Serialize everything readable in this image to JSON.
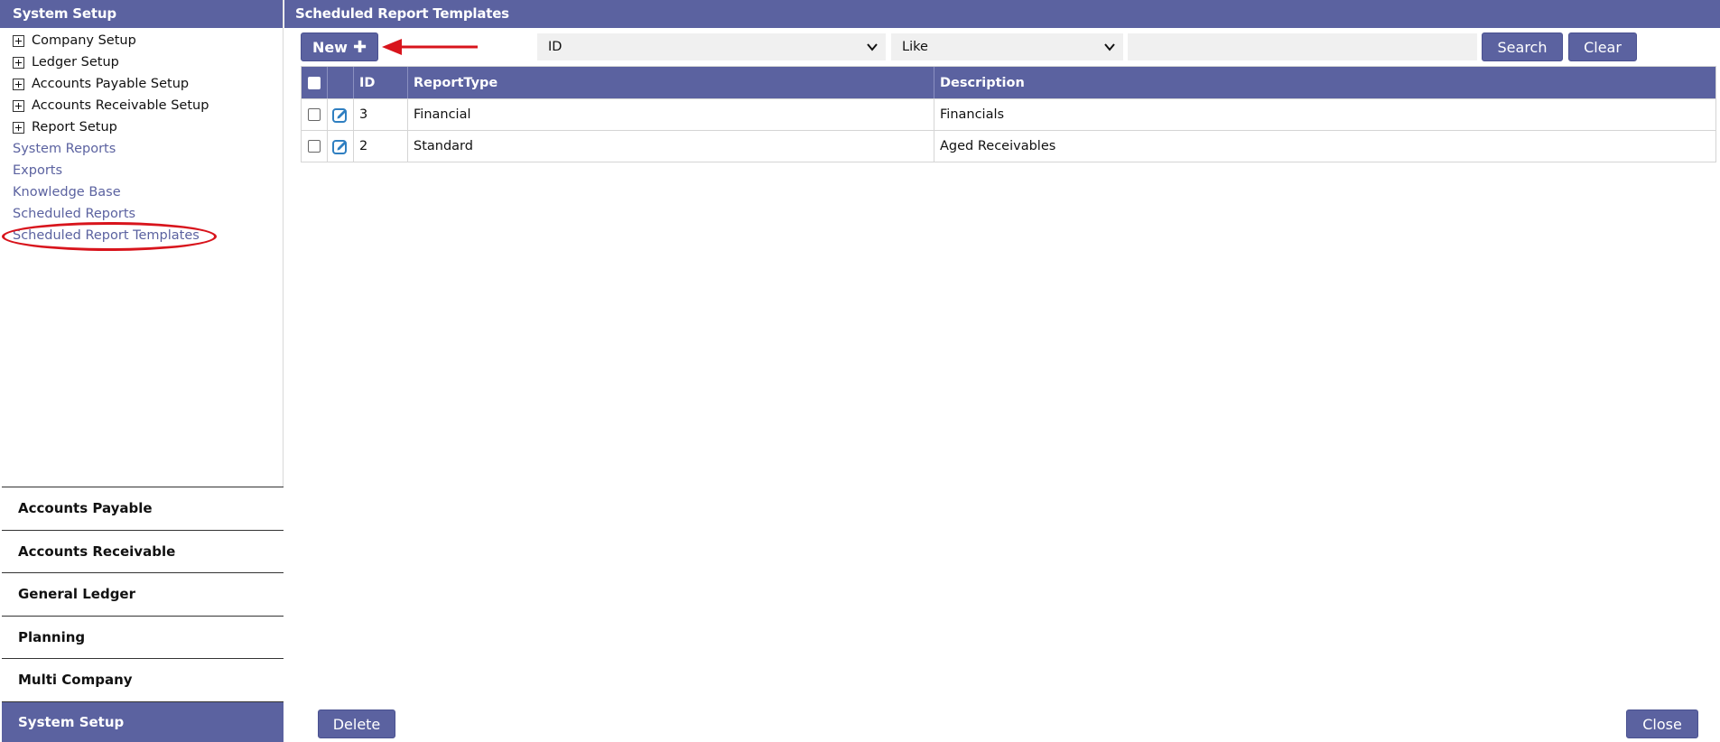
{
  "sidebar": {
    "title": "System Setup",
    "tree": [
      {
        "label": "Company Setup"
      },
      {
        "label": "Ledger Setup"
      },
      {
        "label": "Accounts Payable Setup"
      },
      {
        "label": "Accounts Receivable Setup"
      },
      {
        "label": "Report Setup"
      }
    ],
    "links": [
      {
        "label": "System Reports"
      },
      {
        "label": "Exports"
      },
      {
        "label": "Knowledge Base"
      },
      {
        "label": "Scheduled Reports"
      },
      {
        "label": "Scheduled Report Templates"
      }
    ],
    "nav": [
      {
        "label": "Accounts Payable"
      },
      {
        "label": "Accounts Receivable"
      },
      {
        "label": "General Ledger"
      },
      {
        "label": "Planning"
      },
      {
        "label": "Multi Company"
      },
      {
        "label": "System Setup",
        "active": true
      }
    ]
  },
  "main": {
    "title": "Scheduled Report Templates",
    "toolbar": {
      "new_label": "New",
      "new_icon": "plus-icon",
      "field_value": "ID",
      "operator_value": "Like",
      "search_value": "",
      "search_label": "Search",
      "clear_label": "Clear"
    },
    "grid": {
      "columns": {
        "id": "ID",
        "report_type": "ReportType",
        "description": "Description"
      },
      "rows": [
        {
          "id": "3",
          "report_type": "Financial",
          "description": "Financials"
        },
        {
          "id": "2",
          "report_type": "Standard",
          "description": "Aged Receivables"
        }
      ]
    },
    "footer": {
      "delete_label": "Delete",
      "close_label": "Close"
    }
  },
  "colors": {
    "accent": "#5b62a0",
    "link": "#5b62a0",
    "annotation": "#d8141c",
    "edit_icon": "#2f7fc1"
  }
}
